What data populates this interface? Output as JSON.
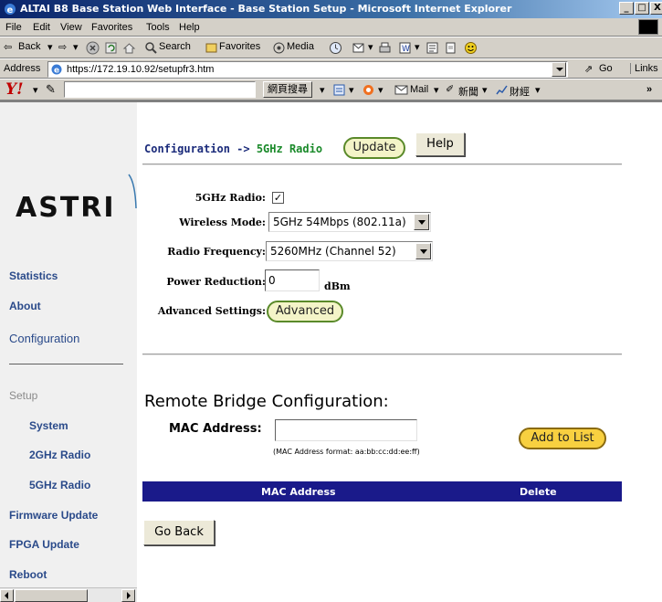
{
  "window": {
    "title": "ALTAI B8 Base Station Web Interface - Base Station Setup - Microsoft Internet Explorer",
    "minimize": "_",
    "maximize": "□",
    "close": "X"
  },
  "menu": [
    "File",
    "Edit",
    "View",
    "Favorites",
    "Tools",
    "Help"
  ],
  "toolbar": {
    "back": "Back",
    "search": "Search",
    "favorites": "Favorites",
    "media": "Media"
  },
  "address": {
    "label": "Address",
    "url": "https://172.19.10.92/setupfr3.htm",
    "go": "Go",
    "links": "Links"
  },
  "yahoo": {
    "search_button": "網頁搜尋",
    "mail": "Mail",
    "news": "新聞",
    "finance": "財經",
    "more": "»"
  },
  "sidebar": {
    "logo": "ASTRI",
    "items": [
      {
        "label": "Statistics"
      },
      {
        "label": "About"
      },
      {
        "label": "Configuration"
      },
      {
        "label": "Setup"
      },
      {
        "label": "System"
      },
      {
        "label": "2GHz Radio"
      },
      {
        "label": "5GHz Radio"
      },
      {
        "label": "Firmware Update"
      },
      {
        "label": "FPGA Update"
      },
      {
        "label": "Reboot"
      }
    ]
  },
  "main": {
    "breadcrumb_part1": "Configuration ->",
    "breadcrumb_part2": "5GHz Radio",
    "update_button": "Update",
    "help_button": "Help",
    "fields": {
      "radio_label": "5GHz Radio:",
      "radio_checked": "✓",
      "wireless_mode_label": "Wireless Mode:",
      "wireless_mode_value": "5GHz 54Mbps (802.11a)",
      "frequency_label": "Radio Frequency:",
      "frequency_value": "5260MHz (Channel 52)",
      "power_label": "Power Reduction:",
      "power_value": "0",
      "power_unit": "dBm",
      "advanced_label": "Advanced Settings:",
      "advanced_button": "Advanced"
    },
    "remote_bridge": {
      "title": "Remote Bridge Configuration:",
      "mac_label": "MAC Address:",
      "mac_value": "",
      "mac_hint": "(MAC Address format: aa:bb:cc:dd:ee:ff)",
      "add_button": "Add to List",
      "col_mac": "MAC Address",
      "col_delete": "Delete"
    },
    "go_back_button": "Go Back"
  }
}
